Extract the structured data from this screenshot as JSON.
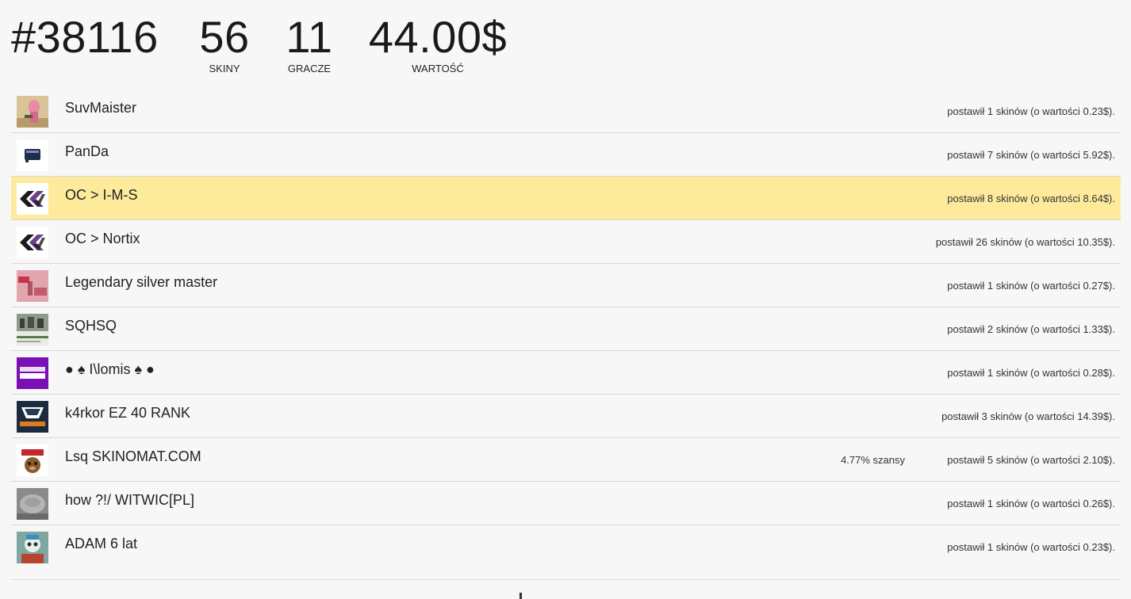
{
  "stats": {
    "round": "#38116",
    "skins_value": "56",
    "skins_label": "SKINY",
    "players_value": "11",
    "players_label": "GRACZE",
    "total_value": "44.00$",
    "total_label": "WARTOŚĆ"
  },
  "players": [
    {
      "name": "SuvMaister",
      "bet": "postawił 1 skinów (o wartości 0.23$).",
      "chance": "",
      "highlight": false,
      "avatar": "pink-character-avatar"
    },
    {
      "name": "PanDa",
      "bet": "postawił 7 skinów (o wartości 5.92$).",
      "chance": "",
      "highlight": false,
      "avatar": "panda-logo-avatar"
    },
    {
      "name": "OC > I-M-S",
      "bet": "postawił 8 skinów (o wartości 8.64$).",
      "chance": "",
      "highlight": true,
      "avatar": "oc-logo-avatar"
    },
    {
      "name": "OC > Nortix",
      "bet": "postawił 26 skinów (o wartości 10.35$).",
      "chance": "",
      "highlight": false,
      "avatar": "oc-logo-avatar"
    },
    {
      "name": "Legendary silver master",
      "bet": "postawił 1 skinów (o wartości 0.27$).",
      "chance": "",
      "highlight": false,
      "avatar": "csgo-logo-avatar"
    },
    {
      "name": "SQHSQ",
      "bet": "postawił 2 skinów (o wartości 1.33$).",
      "chance": "",
      "highlight": false,
      "avatar": "photo-avatar"
    },
    {
      "name": "● ♠ I\\lomis ♠ ●",
      "bet": "postawił 1 skinów (o wartości 0.28$).",
      "chance": "",
      "highlight": false,
      "avatar": "random-power-avatar"
    },
    {
      "name": "k4rkor EZ 40 RANK",
      "bet": "postawił 3 skinów (o wartości 14.39$).",
      "chance": "",
      "highlight": false,
      "avatar": "virtus-pro-avatar"
    },
    {
      "name": "Lsq SKINOMAT.COM",
      "bet": "postawił 5 skinów (o wartości 2.10$).",
      "chance": "4.77% szansy",
      "highlight": false,
      "avatar": "gamer-bear-avatar"
    },
    {
      "name": "how ?!/ WITWIC[PL]",
      "bet": "postawił 1 skinów (o wartości 0.26$).",
      "chance": "",
      "highlight": false,
      "avatar": "grayscale-photo-avatar"
    },
    {
      "name": "ADAM 6 lat",
      "bet": "postawił 1 skinów (o wartości 0.23$).",
      "chance": "",
      "highlight": false,
      "avatar": "skull-avatar"
    }
  ]
}
